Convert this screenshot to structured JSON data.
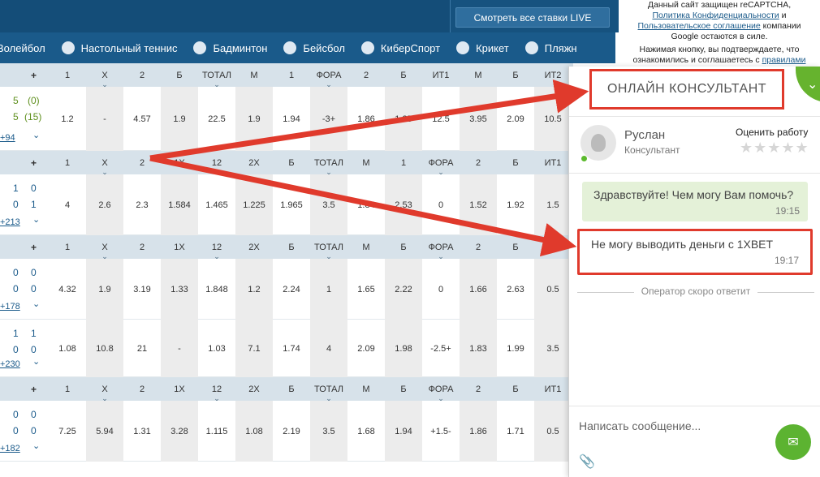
{
  "top": {
    "live_button": "Смотреть все ставки LIVE"
  },
  "captcha": {
    "line1": "Данный сайт защищен reCAPTCHA,",
    "privacy": "Политика Конфиденциальности",
    "and": "и",
    "terms": "Пользовательское соглашение",
    "line3": "компании Google остаются в силе.",
    "line4": "Нажимая кнопку, вы подтверждаете, что ознакомились и соглашаетесь с",
    "rules": "правилами"
  },
  "sports": [
    "Волейбол",
    "Настольный теннис",
    "Бадминтон",
    "Бейсбол",
    "КиберСпорт",
    "Крикет",
    "Пляжн"
  ],
  "table": {
    "groups": [
      {
        "headers": [
          "1",
          "X",
          "2",
          "Б",
          "ТОТАЛ",
          "М",
          "1",
          "ФОРА",
          "2",
          "Б",
          "ИТ1",
          "М",
          "Б",
          "ИТ2"
        ],
        "rows": [
          {
            "score_a": "5",
            "score_b": "5",
            "extra_a": "(0)",
            "extra_b": "(15)",
            "more": "+94",
            "odds": [
              "1.2",
              "-",
              "4.57",
              "1.9",
              "22.5",
              "1.9",
              "1.94",
              "-3+",
              "1.86",
              "1.85",
              "12.5",
              "3.95",
              "2.09",
              "10.5"
            ]
          }
        ]
      },
      {
        "headers": [
          "1",
          "X",
          "2",
          "1X",
          "12",
          "2X",
          "Б",
          "ТОТАЛ",
          "М",
          "1",
          "ФОРА",
          "2",
          "Б",
          "ИТ1"
        ],
        "rows": [
          {
            "score_a": "1",
            "score_b": "0",
            "extra_a": "0",
            "extra_b": "1",
            "more": "+213",
            "odds": [
              "4",
              "2.6",
              "2.3",
              "1.584",
              "1.465",
              "1.225",
              "1.965",
              "3.5",
              "1.84",
              "2.53",
              "0",
              "1.52",
              "1.92",
              "1.5"
            ]
          }
        ]
      },
      {
        "headers": [
          "1",
          "X",
          "2",
          "1X",
          "12",
          "2X",
          "Б",
          "ТОТАЛ",
          "М",
          "Б",
          "ФОРА",
          "2",
          "Б",
          "ИТ1"
        ],
        "rows": [
          {
            "score_a": "0",
            "score_b": "0",
            "extra_a": "0",
            "extra_b": "0",
            "more": "+178",
            "odds": [
              "4.32",
              "1.9",
              "3.19",
              "1.33",
              "1.848",
              "1.2",
              "2.24",
              "1",
              "1.65",
              "2.22",
              "0",
              "1.66",
              "2.63",
              "0.5"
            ]
          },
          {
            "score_a": "1",
            "score_b": "0",
            "extra_a": "1",
            "extra_b": "0",
            "more": "+230",
            "odds": [
              "1.08",
              "10.8",
              "21",
              "-",
              "1.03",
              "7.1",
              "1.74",
              "4",
              "2.09",
              "1.98",
              "-2.5+",
              "1.83",
              "1.99",
              "3.5"
            ]
          }
        ]
      },
      {
        "headers": [
          "1",
          "X",
          "2",
          "1X",
          "12",
          "2X",
          "Б",
          "ТОТАЛ",
          "М",
          "Б",
          "ФОРА",
          "2",
          "Б",
          "ИТ1"
        ],
        "rows": [
          {
            "score_a": "0",
            "score_b": "0",
            "extra_a": "0",
            "extra_b": "0",
            "more": "+182",
            "odds": [
              "7.25",
              "5.94",
              "1.31",
              "3.28",
              "1.115",
              "1.08",
              "2.19",
              "3.5",
              "1.68",
              "1.94",
              "+1.5-",
              "1.86",
              "1.71",
              "0.5"
            ]
          }
        ]
      }
    ]
  },
  "chat": {
    "title": "ОНЛАЙН КОНСУЛЬТАНТ",
    "agent_name": "Руслан",
    "agent_role": "Консультант",
    "rate_label": "Оценить работу",
    "stars": "★★★★★",
    "messages": [
      {
        "text": "Здравствуйте! Чем могу Вам помочь?",
        "time": "19:15"
      },
      {
        "text": "Не могу выводить деньги с 1XBET",
        "time": "19:17"
      }
    ],
    "operator_notice": "Оператор скоро ответит",
    "input_placeholder": "Написать сообщение..."
  },
  "colors": {
    "accent_red": "#e03a2c",
    "chat_green": "#5cb331",
    "nav_blue": "#1a5a8a"
  }
}
